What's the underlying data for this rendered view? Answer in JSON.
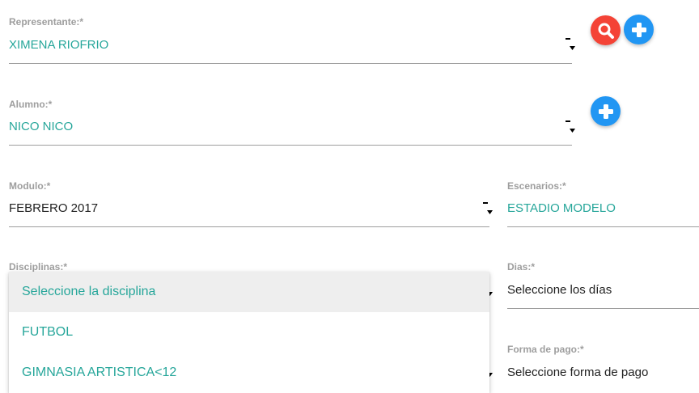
{
  "colors": {
    "accent": "#26a69a",
    "search_button": "#f44336",
    "add_button": "#2196f3"
  },
  "representante": {
    "label": "Representante:*",
    "value": "XIMENA RIOFRIO"
  },
  "alumno": {
    "label": "Alumno:*",
    "value": "NICO NICO"
  },
  "modulo": {
    "label": "Modulo:*",
    "value": "FEBRERO 2017"
  },
  "escenarios": {
    "label": "Escenarios:*",
    "value": "ESTADIO MODELO"
  },
  "disciplinas": {
    "label": "Disciplinas:*",
    "options": [
      "Seleccione la disciplina",
      "FUTBOL",
      "GIMNASIA ARTISTICA<12"
    ],
    "selected_index": 0
  },
  "dias": {
    "label": "Dias:*",
    "value": "Seleccione los días"
  },
  "forma_pago": {
    "label": "Forma de pago:*",
    "value": "Seleccione forma de pago"
  },
  "icons": {
    "search": "search-icon",
    "add": "plus-icon",
    "caret": "caret-down-icon"
  }
}
